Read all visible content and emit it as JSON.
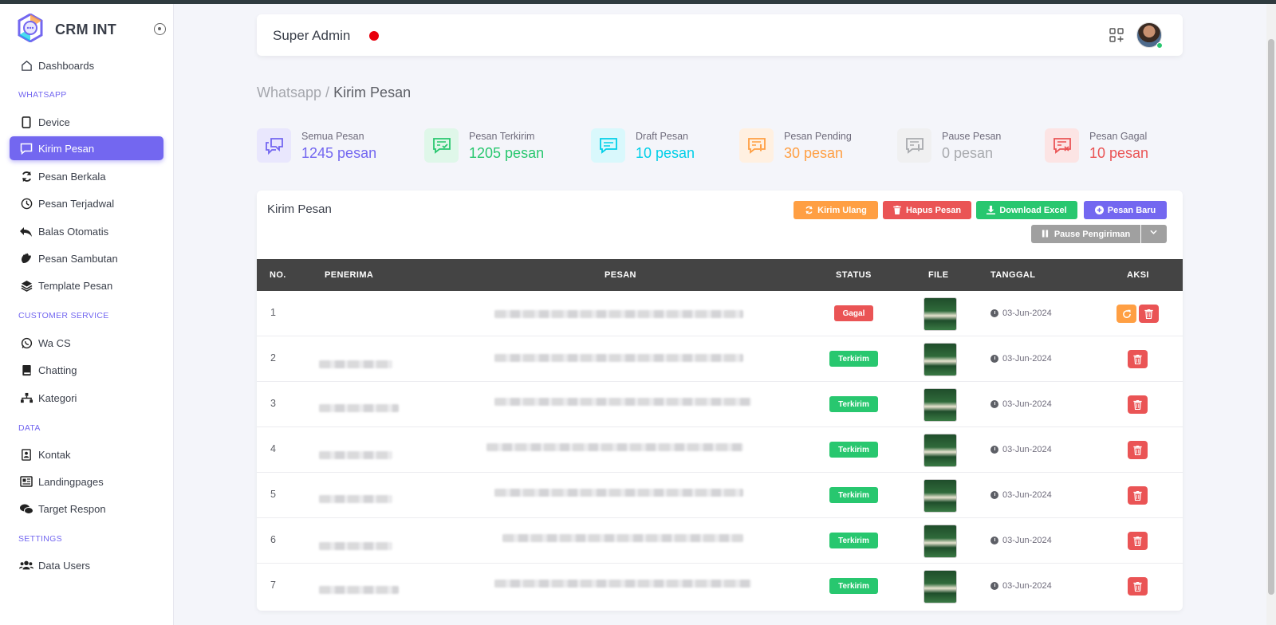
{
  "brand": {
    "name": "CRM INT"
  },
  "sidebar": {
    "items": [
      {
        "label": "Dashboards",
        "icon": "home-icon"
      },
      {
        "section": "WHATSAPP"
      },
      {
        "label": "Device",
        "icon": "phone-icon"
      },
      {
        "label": "Kirim Pesan",
        "icon": "message-icon",
        "active": true
      },
      {
        "label": "Pesan Berkala",
        "icon": "sync-icon"
      },
      {
        "label": "Pesan Terjadwal",
        "icon": "clock-icon"
      },
      {
        "label": "Balas Otomatis",
        "icon": "reply-all-icon"
      },
      {
        "label": "Pesan Sambutan",
        "icon": "wave-hand-icon"
      },
      {
        "label": "Template Pesan",
        "icon": "layers-icon"
      },
      {
        "section": "CUSTOMER SERVICE"
      },
      {
        "label": "Wa CS",
        "icon": "whatsapp-icon"
      },
      {
        "label": "Chatting",
        "icon": "book-icon"
      },
      {
        "label": "Kategori",
        "icon": "sitemap-icon"
      },
      {
        "section": "DATA"
      },
      {
        "label": "Kontak",
        "icon": "contact-book-icon"
      },
      {
        "label": "Landingpages",
        "icon": "newspaper-icon"
      },
      {
        "label": "Target Respon",
        "icon": "comments-icon"
      },
      {
        "section": "SETTINGS"
      },
      {
        "label": "Data Users",
        "icon": "users-icon"
      }
    ]
  },
  "header": {
    "title": "Super Admin"
  },
  "breadcrumb": {
    "parent": "Whatsapp",
    "separator": " / ",
    "current": "Kirim Pesan"
  },
  "stats": [
    {
      "label": "Semua Pesan",
      "value": "1245 pesan",
      "color": "#7367f0",
      "bg": "#e9e7fd",
      "icon": "chat-bubbles-icon"
    },
    {
      "label": "Pesan Terkirim",
      "value": "1205 pesan",
      "color": "#28c76f",
      "bg": "#dff7e9",
      "icon": "message-check-icon"
    },
    {
      "label": "Draft Pesan",
      "value": "10 pesan",
      "color": "#00cfe8",
      "bg": "#d9f8fc",
      "icon": "message-text-icon"
    },
    {
      "label": "Pesan Pending",
      "value": "30 pesan",
      "color": "#ff9f43",
      "bg": "#fff0e1",
      "icon": "message-alert-icon"
    },
    {
      "label": "Pause Pesan",
      "value": "0 pesan",
      "color": "#a8aaae",
      "bg": "#f0f0f1",
      "icon": "message-pause-icon"
    },
    {
      "label": "Pesan Gagal",
      "value": "10 pesan",
      "color": "#ea5455",
      "bg": "#fce4e4",
      "icon": "message-x-icon"
    }
  ],
  "card": {
    "title": "Kirim Pesan",
    "buttons": {
      "resend": "Kirim Ulang",
      "delete": "Hapus Pesan",
      "download": "Download Excel",
      "new": "Pesan Baru",
      "pause": "Pause Pengiriman"
    }
  },
  "table": {
    "headers": {
      "no": "NO.",
      "recipient": "PENERIMA",
      "message": "PESAN",
      "status": "STATUS",
      "file": "FILE",
      "date": "TANGGAL",
      "action": "AKSI"
    },
    "rows": [
      {
        "no": "1",
        "status": "Gagal",
        "date": "03-Jun-2024"
      },
      {
        "no": "2",
        "status": "Terkirim",
        "date": "03-Jun-2024"
      },
      {
        "no": "3",
        "status": "Terkirim",
        "date": "03-Jun-2024"
      },
      {
        "no": "4",
        "status": "Terkirim",
        "date": "03-Jun-2024"
      },
      {
        "no": "5",
        "status": "Terkirim",
        "date": "03-Jun-2024"
      },
      {
        "no": "6",
        "status": "Terkirim",
        "date": "03-Jun-2024"
      },
      {
        "no": "7",
        "status": "Terkirim",
        "date": "03-Jun-2024"
      }
    ]
  }
}
